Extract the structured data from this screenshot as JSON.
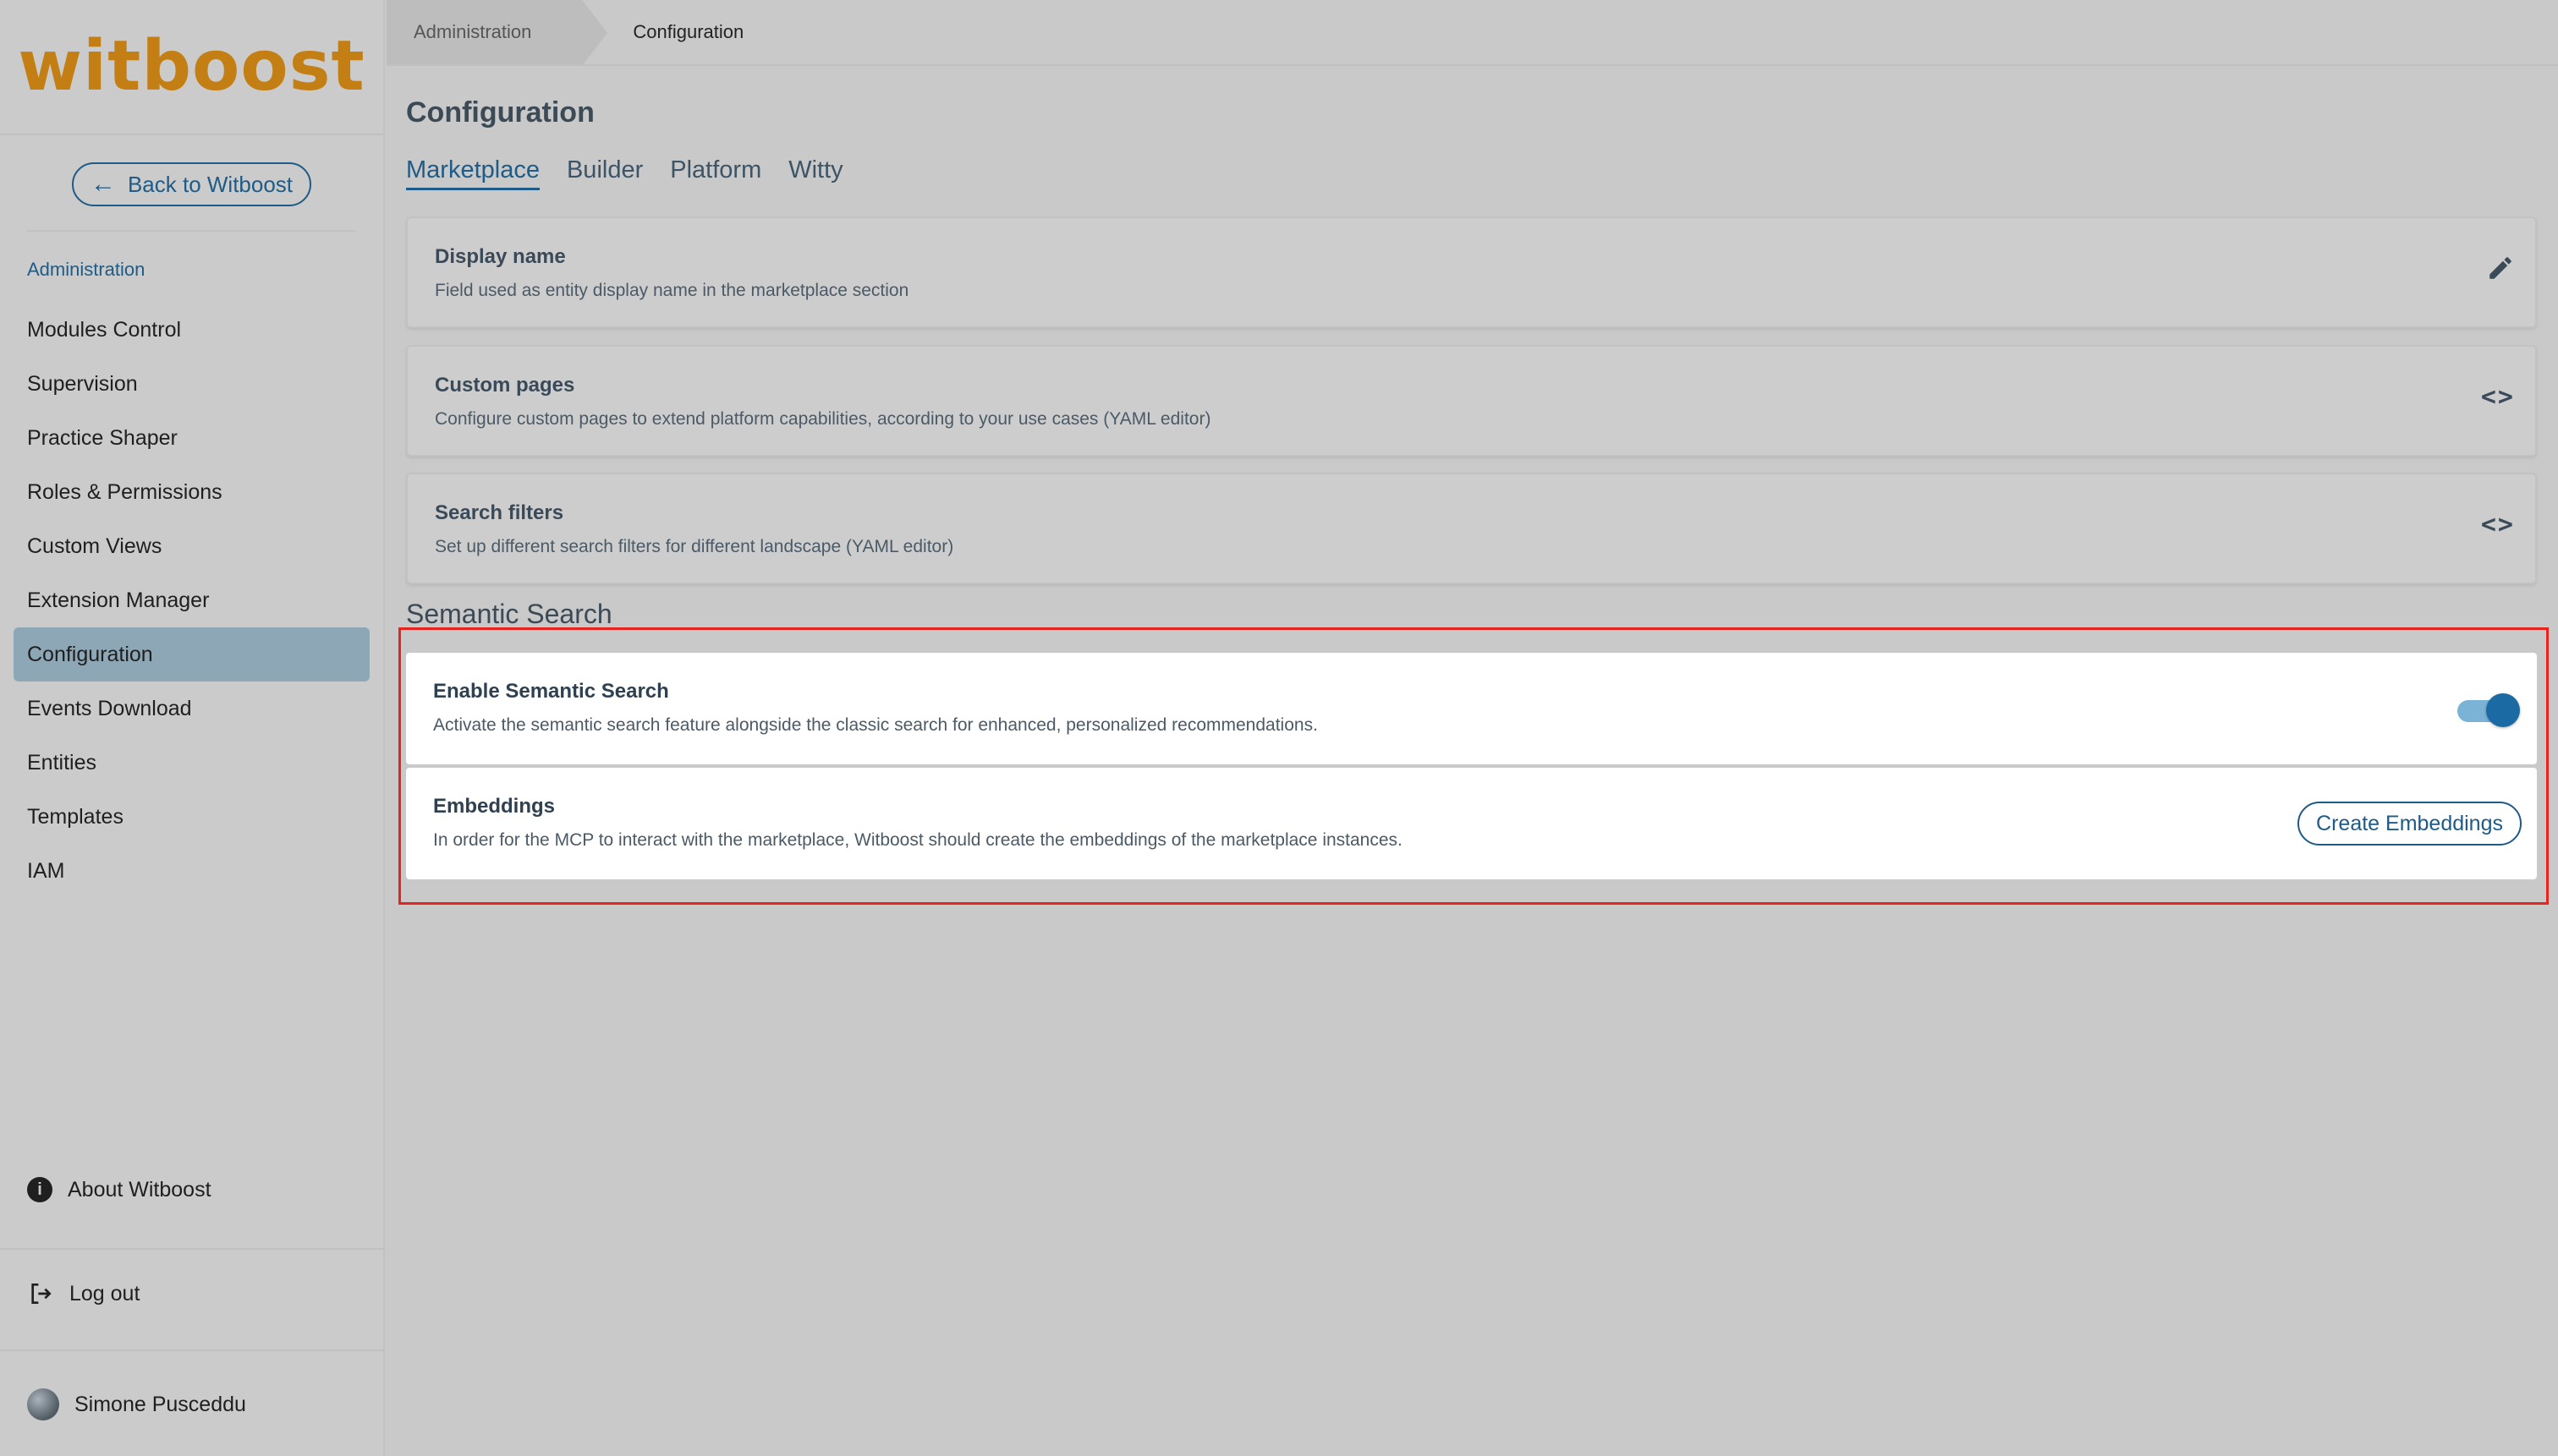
{
  "sidebar": {
    "logo": "witboost",
    "back_label": "Back to Witboost",
    "section_label": "Administration",
    "items": [
      {
        "label": "Modules Control"
      },
      {
        "label": "Supervision"
      },
      {
        "label": "Practice Shaper"
      },
      {
        "label": "Roles & Permissions"
      },
      {
        "label": "Custom Views"
      },
      {
        "label": "Extension Manager"
      },
      {
        "label": "Configuration"
      },
      {
        "label": "Events Download"
      },
      {
        "label": "Entities"
      },
      {
        "label": "Templates"
      },
      {
        "label": "IAM"
      }
    ],
    "active_item": "Configuration",
    "about_label": "About Witboost",
    "logout_label": "Log out",
    "user_name": "Simone Pusceddu"
  },
  "breadcrumb": {
    "parent": "Administration",
    "current": "Configuration"
  },
  "page": {
    "title": "Configuration",
    "tabs": [
      {
        "label": "Marketplace"
      },
      {
        "label": "Builder"
      },
      {
        "label": "Platform"
      },
      {
        "label": "Witty"
      }
    ],
    "active_tab": "Marketplace"
  },
  "cards": [
    {
      "title": "Display name",
      "description": "Field used as entity display name in the marketplace section",
      "icon": "pencil-icon"
    },
    {
      "title": "Custom pages",
      "description": "Configure custom pages to extend platform capabilities, according to your use cases (YAML editor)",
      "icon": "code-icon"
    },
    {
      "title": "Search filters",
      "description": "Set up different search filters for different landscape (YAML editor)",
      "icon": "code-icon"
    }
  ],
  "semantic_search": {
    "section_title": "Semantic Search",
    "enable": {
      "title": "Enable Semantic Search",
      "description": "Activate the semantic search feature alongside the classic search for enhanced, personalized recommendations.",
      "enabled": true
    },
    "embeddings": {
      "title": "Embeddings",
      "description": "In order for the MCP to interact with the marketplace, Witboost should create the embeddings of the marketplace instances.",
      "button_label": "Create Embeddings"
    }
  },
  "colors": {
    "accent": "#1e5b86",
    "logo": "#c47f14",
    "highlight_border": "#e8231f",
    "active_menu": "#8ea7b7"
  }
}
